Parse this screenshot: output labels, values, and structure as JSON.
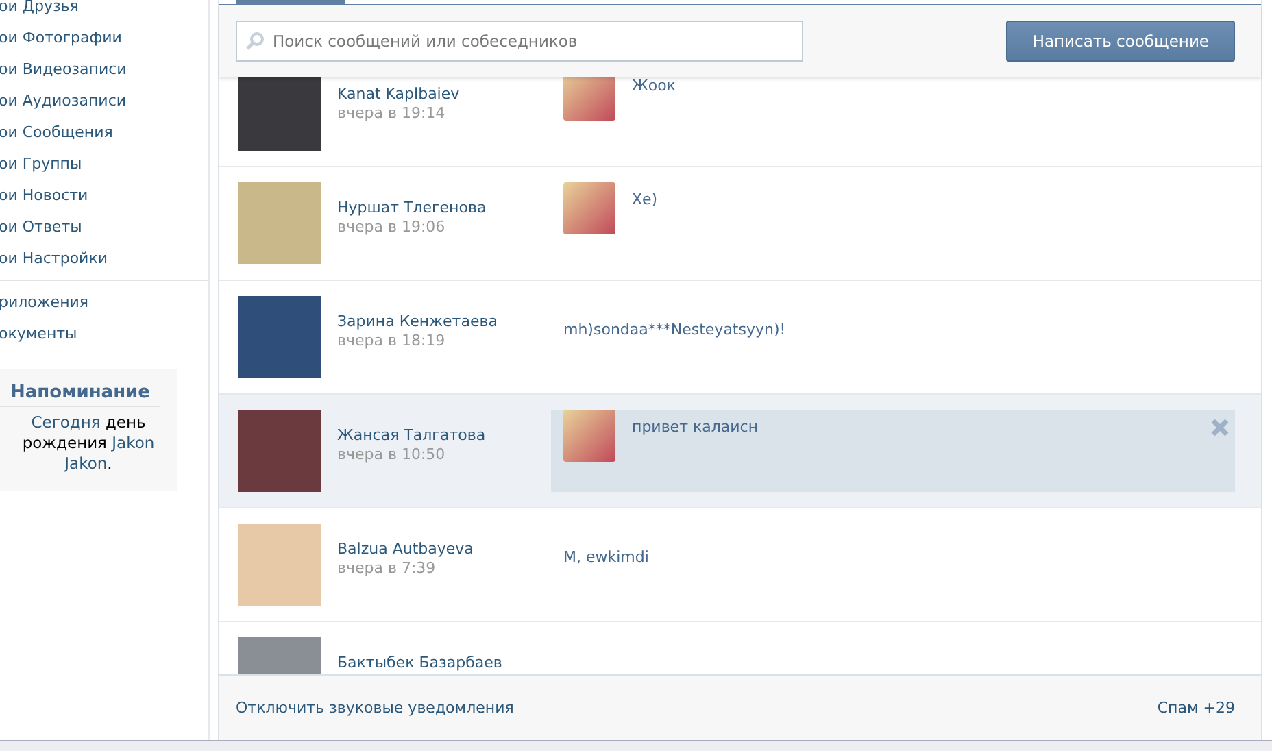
{
  "sidebar": {
    "items": [
      {
        "label": "ои Друзья"
      },
      {
        "label": "ои Фотографии"
      },
      {
        "label": "ои Видеозаписи"
      },
      {
        "label": "ои Аудиозаписи"
      },
      {
        "label": "ои Сообщения"
      },
      {
        "label": "ои Группы"
      },
      {
        "label": "ои Новости"
      },
      {
        "label": "ои Ответы"
      },
      {
        "label": "ои Настройки"
      }
    ],
    "extra_items": [
      {
        "label": "риложения"
      },
      {
        "label": "окументы"
      }
    ],
    "reminder": {
      "title": "Напоминание",
      "text": "Сегодня **день рождения** Jakon Jakon**.**"
    }
  },
  "search": {
    "placeholder": "Поиск сообщений или собеседников"
  },
  "compose_button": "Написать сообщение",
  "dialogs": [
    {
      "name": "Kanat Kaplbaiev",
      "time": "вчера в 19:14",
      "message": "Жоок",
      "with_photo": true,
      "highlighted": false
    },
    {
      "name": "Нуршат Тлегенова",
      "time": "вчера в 19:06",
      "message": "Хе)",
      "with_photo": true,
      "highlighted": false
    },
    {
      "name": "Зарина Кенжетаева",
      "time": "вчера в 18:19",
      "message": "mh)sondaa***Nesteyatsyyn)!",
      "with_photo": false,
      "highlighted": false
    },
    {
      "name": "Жансая Талгатова",
      "time": "вчера в 10:50",
      "message": "привет калаисн",
      "with_photo": true,
      "highlighted": true
    },
    {
      "name": "Balzua Autbayeva",
      "time": "вчера в 7:39",
      "message": "M, ewkimdi",
      "with_photo": false,
      "highlighted": false
    },
    {
      "name": "Бактыбек Базарбаев",
      "with_photo": false,
      "highlighted": false
    }
  ],
  "footer": {
    "mute_link": "Отключить звуковые уведомления",
    "spam_link": "Спам +29"
  }
}
